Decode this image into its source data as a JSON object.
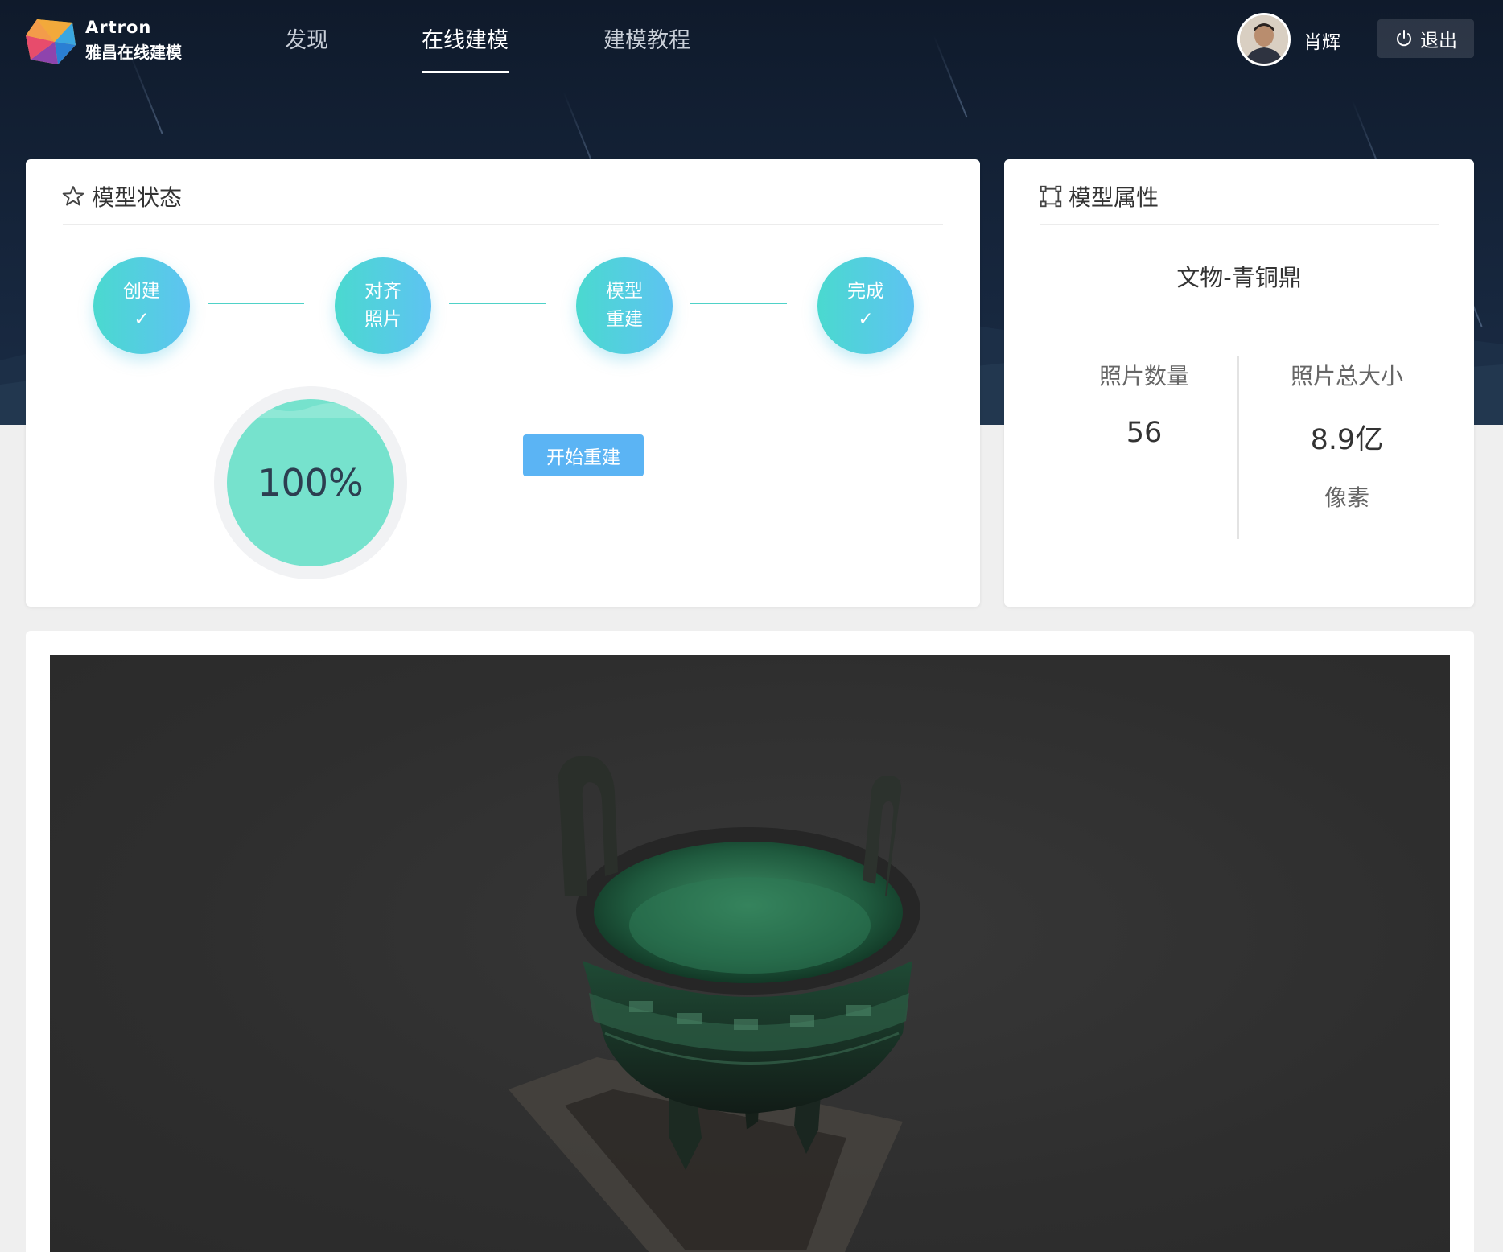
{
  "brand": {
    "name_en": "Artron",
    "name_cn": "雅昌在线建模"
  },
  "nav": [
    {
      "label": "发现",
      "active": false
    },
    {
      "label": "在线建模",
      "active": true
    },
    {
      "label": "建模教程",
      "active": false
    }
  ],
  "user": {
    "name": "肖辉",
    "logout_label": "退出"
  },
  "status_card": {
    "title": "模型状态",
    "steps": [
      {
        "line1": "创建",
        "line2": "✓"
      },
      {
        "line1": "对齐",
        "line2": "照片"
      },
      {
        "line1": "模型",
        "line2": "重建"
      },
      {
        "line1": "完成",
        "line2": "✓"
      }
    ],
    "progress_percent": 100,
    "progress_label": "100%",
    "start_button": "开始重建"
  },
  "props_card": {
    "title": "模型属性",
    "model_name": "文物-青铜鼎",
    "photo_count_label": "照片数量",
    "photo_count_value": "56",
    "photo_size_label": "照片总大小",
    "photo_size_value": "8.9亿",
    "photo_size_unit": "像素"
  },
  "colors": {
    "accent": "#5bb4f4",
    "step_gradient_start": "#4ad9cf",
    "step_gradient_end": "#5ec3f2",
    "progress_fill": "#76e2cd",
    "header_bg": "#0f1a2b",
    "viewer_bg": "#2e2e2e"
  },
  "viewer": {
    "object_icon": "bronze-ding-model"
  }
}
